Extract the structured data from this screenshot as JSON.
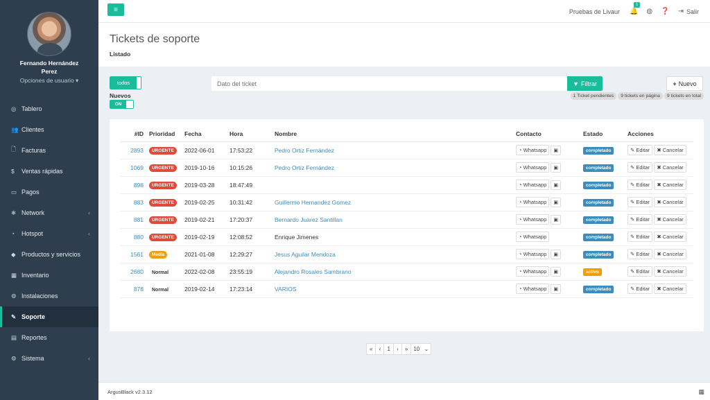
{
  "app": {
    "version": "ArgusBlack v2.3.12"
  },
  "user": {
    "name_line1": "Fernando Hernández",
    "name_line2": "Perez",
    "options": "Opciones de usuario ▾"
  },
  "sidebar": {
    "items": [
      {
        "label": "Tablero",
        "icon": "dashboard-icon",
        "glyph": "◎",
        "chevron": ""
      },
      {
        "label": "Clientes",
        "icon": "users-icon",
        "glyph": "👥",
        "chevron": ""
      },
      {
        "label": "Facturas",
        "icon": "file-icon",
        "glyph": "🗋",
        "chevron": ""
      },
      {
        "label": "Ventas rápidas",
        "icon": "dollar-icon",
        "glyph": "$",
        "chevron": ""
      },
      {
        "label": "Pagos",
        "icon": "money-icon",
        "glyph": "▭",
        "chevron": ""
      },
      {
        "label": "Network",
        "icon": "network-icon",
        "glyph": "❄",
        "chevron": "‹"
      },
      {
        "label": "Hotspot",
        "icon": "wifi-icon",
        "glyph": "◔",
        "chevron": "‹"
      },
      {
        "label": "Productos y servicios",
        "icon": "tag-icon",
        "glyph": "◆",
        "chevron": ""
      },
      {
        "label": "Inventario",
        "icon": "cubes-icon",
        "glyph": "▦",
        "chevron": ""
      },
      {
        "label": "Instalaciones",
        "icon": "wrench-icon",
        "glyph": "⚙",
        "chevron": ""
      },
      {
        "label": "Soporte",
        "icon": "support-wrench-icon",
        "glyph": "✎",
        "chevron": ""
      },
      {
        "label": "Reportes",
        "icon": "reports-icon",
        "glyph": "▤",
        "chevron": ""
      },
      {
        "label": "Sistema",
        "icon": "cogs-icon",
        "glyph": "⚙",
        "chevron": "‹"
      }
    ],
    "active_index": 10
  },
  "topbar": {
    "menu_glyph": "≡",
    "org": "Pruebas de Livaur",
    "bell_count": "1",
    "logout": "Salir"
  },
  "header": {
    "title": "Tickets de soporte",
    "subtitle": "Listado"
  },
  "filters": {
    "todos": "todos",
    "nuevos_label": "Nuevos",
    "nuevos_toggle": "ON",
    "search_placeholder": "Dato del ticket",
    "filter_button": "Filtrar",
    "new_button": "Nuevo",
    "counters": [
      "1 Ticket pendientes",
      "9 tickets en página",
      "9 tickets en total"
    ]
  },
  "table": {
    "headers": [
      "#ID",
      "Prioridad",
      "Fecha",
      "Hora",
      "Nombre",
      "Contacto",
      "Estado",
      "Acciones"
    ],
    "whatsapp_label": "Whatsapp",
    "edit_label": "Editar",
    "cancel_label": "Cancelar",
    "rows": [
      {
        "id": "2893",
        "priority": "URGENTE",
        "prio_class": "urgente",
        "date": "2022-06-01",
        "time": "17:53:22",
        "name": "Pedro Ortiz Fernández",
        "link": true,
        "card": true,
        "status": "completado",
        "status_class": "completado"
      },
      {
        "id": "1069",
        "priority": "URGENTE",
        "prio_class": "urgente",
        "date": "2019-10-16",
        "time": "10:15:26",
        "name": "Pedro Ortiz Fernández",
        "link": true,
        "card": true,
        "status": "completado",
        "status_class": "completado"
      },
      {
        "id": "898",
        "priority": "URGENTE",
        "prio_class": "urgente",
        "date": "2019-03-28",
        "time": "18:47:49",
        "name": "",
        "link": false,
        "card": true,
        "status": "completado",
        "status_class": "completado"
      },
      {
        "id": "883",
        "priority": "URGENTE",
        "prio_class": "urgente",
        "date": "2019-02-25",
        "time": "10:31:42",
        "name": "Guillermo Hernandez Gomez",
        "link": true,
        "card": true,
        "status": "completado",
        "status_class": "completado"
      },
      {
        "id": "881",
        "priority": "URGENTE",
        "prio_class": "urgente",
        "date": "2019-02-21",
        "time": "17:20:37",
        "name": "Bernardo Juarez Santillan",
        "link": true,
        "card": true,
        "status": "completado",
        "status_class": "completado"
      },
      {
        "id": "880",
        "priority": "URGENTE",
        "prio_class": "urgente",
        "date": "2019-02-19",
        "time": "12:08:52",
        "name": "Enrique Jimenes",
        "link": false,
        "card": false,
        "status": "completado",
        "status_class": "completado"
      },
      {
        "id": "1561",
        "priority": "Media",
        "prio_class": "media",
        "date": "2021-01-08",
        "time": "12:29:27",
        "name": "Jesus Aguilar Mendoza",
        "link": true,
        "card": true,
        "status": "completado",
        "status_class": "completado"
      },
      {
        "id": "2680",
        "priority": "Normal",
        "prio_class": "normal",
        "date": "2022-02-08",
        "time": "23:55:19",
        "name": "Alejandro Rosales Sambrano",
        "link": true,
        "card": true,
        "status": "activo",
        "status_class": "activo"
      },
      {
        "id": "878",
        "priority": "Normal",
        "prio_class": "normal",
        "date": "2019-02-14",
        "time": "17:23:14",
        "name": "VARIOS",
        "link": true,
        "card": true,
        "status": "completado",
        "status_class": "completado"
      }
    ]
  },
  "pagination": {
    "first": "«",
    "prev": "‹",
    "current": "1",
    "next": "›",
    "last": "»",
    "per_page": "10"
  },
  "colors": {
    "accent": "#1abc9c",
    "sidebar": "#2e3e4e",
    "danger": "#dd4b39",
    "warning": "#f39c12",
    "info": "#3c8dbc"
  }
}
